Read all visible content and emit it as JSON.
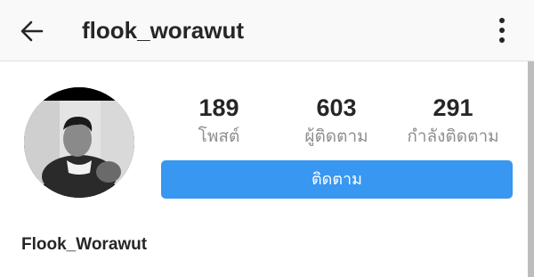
{
  "header": {
    "username": "flook_worawut",
    "back_icon": "back-arrow-icon",
    "more_icon": "more-vertical-icon"
  },
  "profile": {
    "stats": [
      {
        "value": "189",
        "label": "โพสต์"
      },
      {
        "value": "603",
        "label": "ผู้ติดตาม"
      },
      {
        "value": "291",
        "label": "กำลังติดตาม"
      }
    ],
    "follow_label": "ติดตาม",
    "display_name": "Flook_Worawut"
  },
  "colors": {
    "accent": "#3897f0",
    "text": "#262626",
    "muted": "#8e8e8e"
  }
}
